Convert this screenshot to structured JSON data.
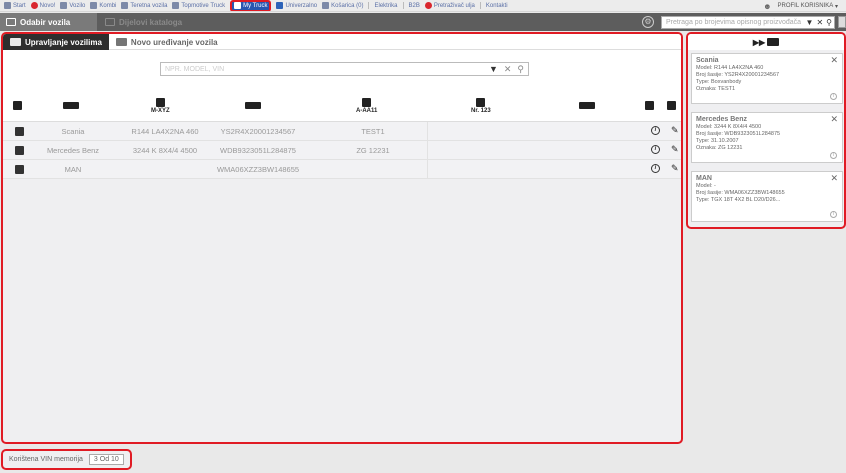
{
  "topnav": {
    "items": [
      {
        "label": "Start",
        "icon": "home-icon"
      },
      {
        "label": "Novo!",
        "icon": "new-icon"
      },
      {
        "label": "Vozilo",
        "icon": "car-icon"
      },
      {
        "label": "Kombi",
        "icon": "van-icon"
      },
      {
        "label": "Teretna vozila",
        "icon": "truck-icon"
      },
      {
        "label": "Topmotive Truck",
        "icon": "truck-icon"
      },
      {
        "label": "My Truck",
        "icon": "mytruck-icon",
        "active": true
      },
      {
        "label": "Univerzalno",
        "icon": "universal-icon"
      },
      {
        "label": "Košarica (0)",
        "icon": "cart-icon"
      },
      {
        "label": "Elektrika",
        "icon": ""
      },
      {
        "label": "B2B",
        "icon": ""
      },
      {
        "label": "Pretraživač ulja",
        "icon": "oil-icon"
      },
      {
        "label": "Kontakti",
        "icon": ""
      }
    ],
    "profile": "PROFIL KORISNIKA"
  },
  "secondbar": {
    "active_tab": "Odabir vozila",
    "inactive_tab": "Dijelovi kataloga",
    "search_placeholder": "Pretraga po brojevima opisnog proizvođača"
  },
  "main": {
    "tabs": [
      {
        "label": "Upravljanje vozilima"
      },
      {
        "label": "Novo uređivanje vozila"
      }
    ],
    "search_placeholder": "NPR. MODEL, VIN",
    "headers": {
      "model": "M-XYZ",
      "plate": "A-AA11",
      "number": "Nr. 123"
    },
    "rows": [
      {
        "brand": "Scania",
        "model": "R144 LA4X2NA 460",
        "vin": "YS2R4X20001234567",
        "plate": "TEST1"
      },
      {
        "brand": "Mercedes Benz",
        "model": "3244 K 8X4/4 4500",
        "vin": "WDB9323051L284875",
        "plate": "ZG 12231"
      },
      {
        "brand": "MAN",
        "model": "",
        "vin": "WMA06XZZ3BW148655",
        "plate": ""
      }
    ]
  },
  "sidebar": {
    "cards": [
      {
        "title": "Scania",
        "lines": [
          "Model: R144 LA4X2NA 460",
          "Broj šasije: YS2R4X20001234567",
          "Type: Boxvanbody",
          "Oznaka: TEST1"
        ]
      },
      {
        "title": "Mercedes Benz",
        "lines": [
          "Model: 3244 K 8X4/4 4500",
          "Broj šasije: WDB9323051L284875",
          "Type: 31.10.2007",
          "Oznaka: ZG 12231"
        ]
      },
      {
        "title": "MAN",
        "lines": [
          "Model: -",
          "Broj šasije: WMA06XZZ3BW148655",
          "Type: TGX 18T 4X2 BL D20/D26..."
        ]
      }
    ]
  },
  "footer": {
    "vin_label": "Korištena VIN memorija",
    "vin_value": "3 Od 10"
  },
  "colors": {
    "accent_red": "#e01b24",
    "active_blue": "#2855b0",
    "dark_tab": "#2e2e2e"
  }
}
